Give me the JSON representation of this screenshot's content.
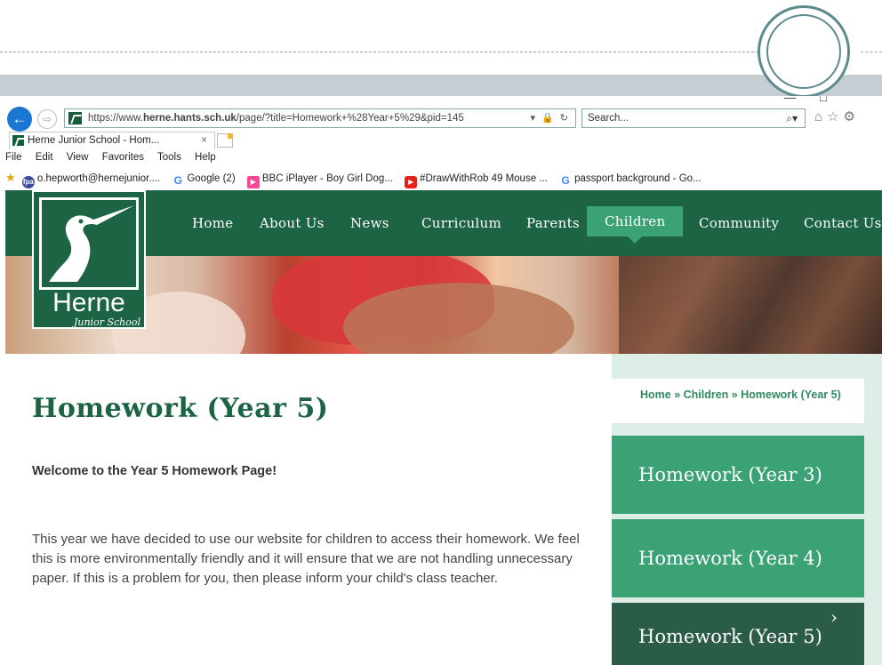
{
  "window": {
    "minimize_glyph": "—",
    "maximize_glyph": "□"
  },
  "address_bar": {
    "url_prefix": "https://www.",
    "url_domain": "herne.hants.sch.uk",
    "url_path": "/page/?title=Homework+%28Year+5%29&pid=145",
    "search_placeholder": "Search...",
    "search_icon": "⌕▾",
    "right_icons": "⌂☆⚙"
  },
  "tab": {
    "title": "Herne Junior School - Hom...",
    "close": "×"
  },
  "menu": [
    "File",
    "Edit",
    "View",
    "Favorites",
    "Tools",
    "Help"
  ],
  "favorites": [
    {
      "icon_text": "fpa",
      "label": "o.hepworth@hernejunior...."
    },
    {
      "icon_text": "G",
      "label": "Google (2)"
    },
    {
      "icon_text": "▶",
      "label": "BBC iPlayer - Boy Girl Dog..."
    },
    {
      "icon_text": "▶",
      "label": "#DrawWithRob 49 Mouse ..."
    },
    {
      "icon_text": "G",
      "label": "passport background - Go..."
    }
  ],
  "site": {
    "logo_name": "Herne",
    "logo_sub": "Junior School",
    "nav": [
      "Home",
      "About Us",
      "News",
      "Curriculum",
      "Parents",
      "Children",
      "Community",
      "Contact Us"
    ],
    "active_nav": "Children"
  },
  "content": {
    "title": "Homework (Year 5)",
    "welcome": "Welcome to the Year 5 Homework Page!",
    "paragraph": "This year we have decided to use our website for children to access their homework. We feel this is more environmentally friendly and it will ensure that we are not handling unnecessary paper. If this is a problem for you, then please inform your child's class teacher."
  },
  "sidebar": {
    "breadcrumb": "Home » Children » Homework (Year 5)",
    "items": [
      "Homework (Year 3)",
      "Homework (Year 4)",
      "Homework (Year 5)"
    ],
    "current_chevron": "›"
  }
}
